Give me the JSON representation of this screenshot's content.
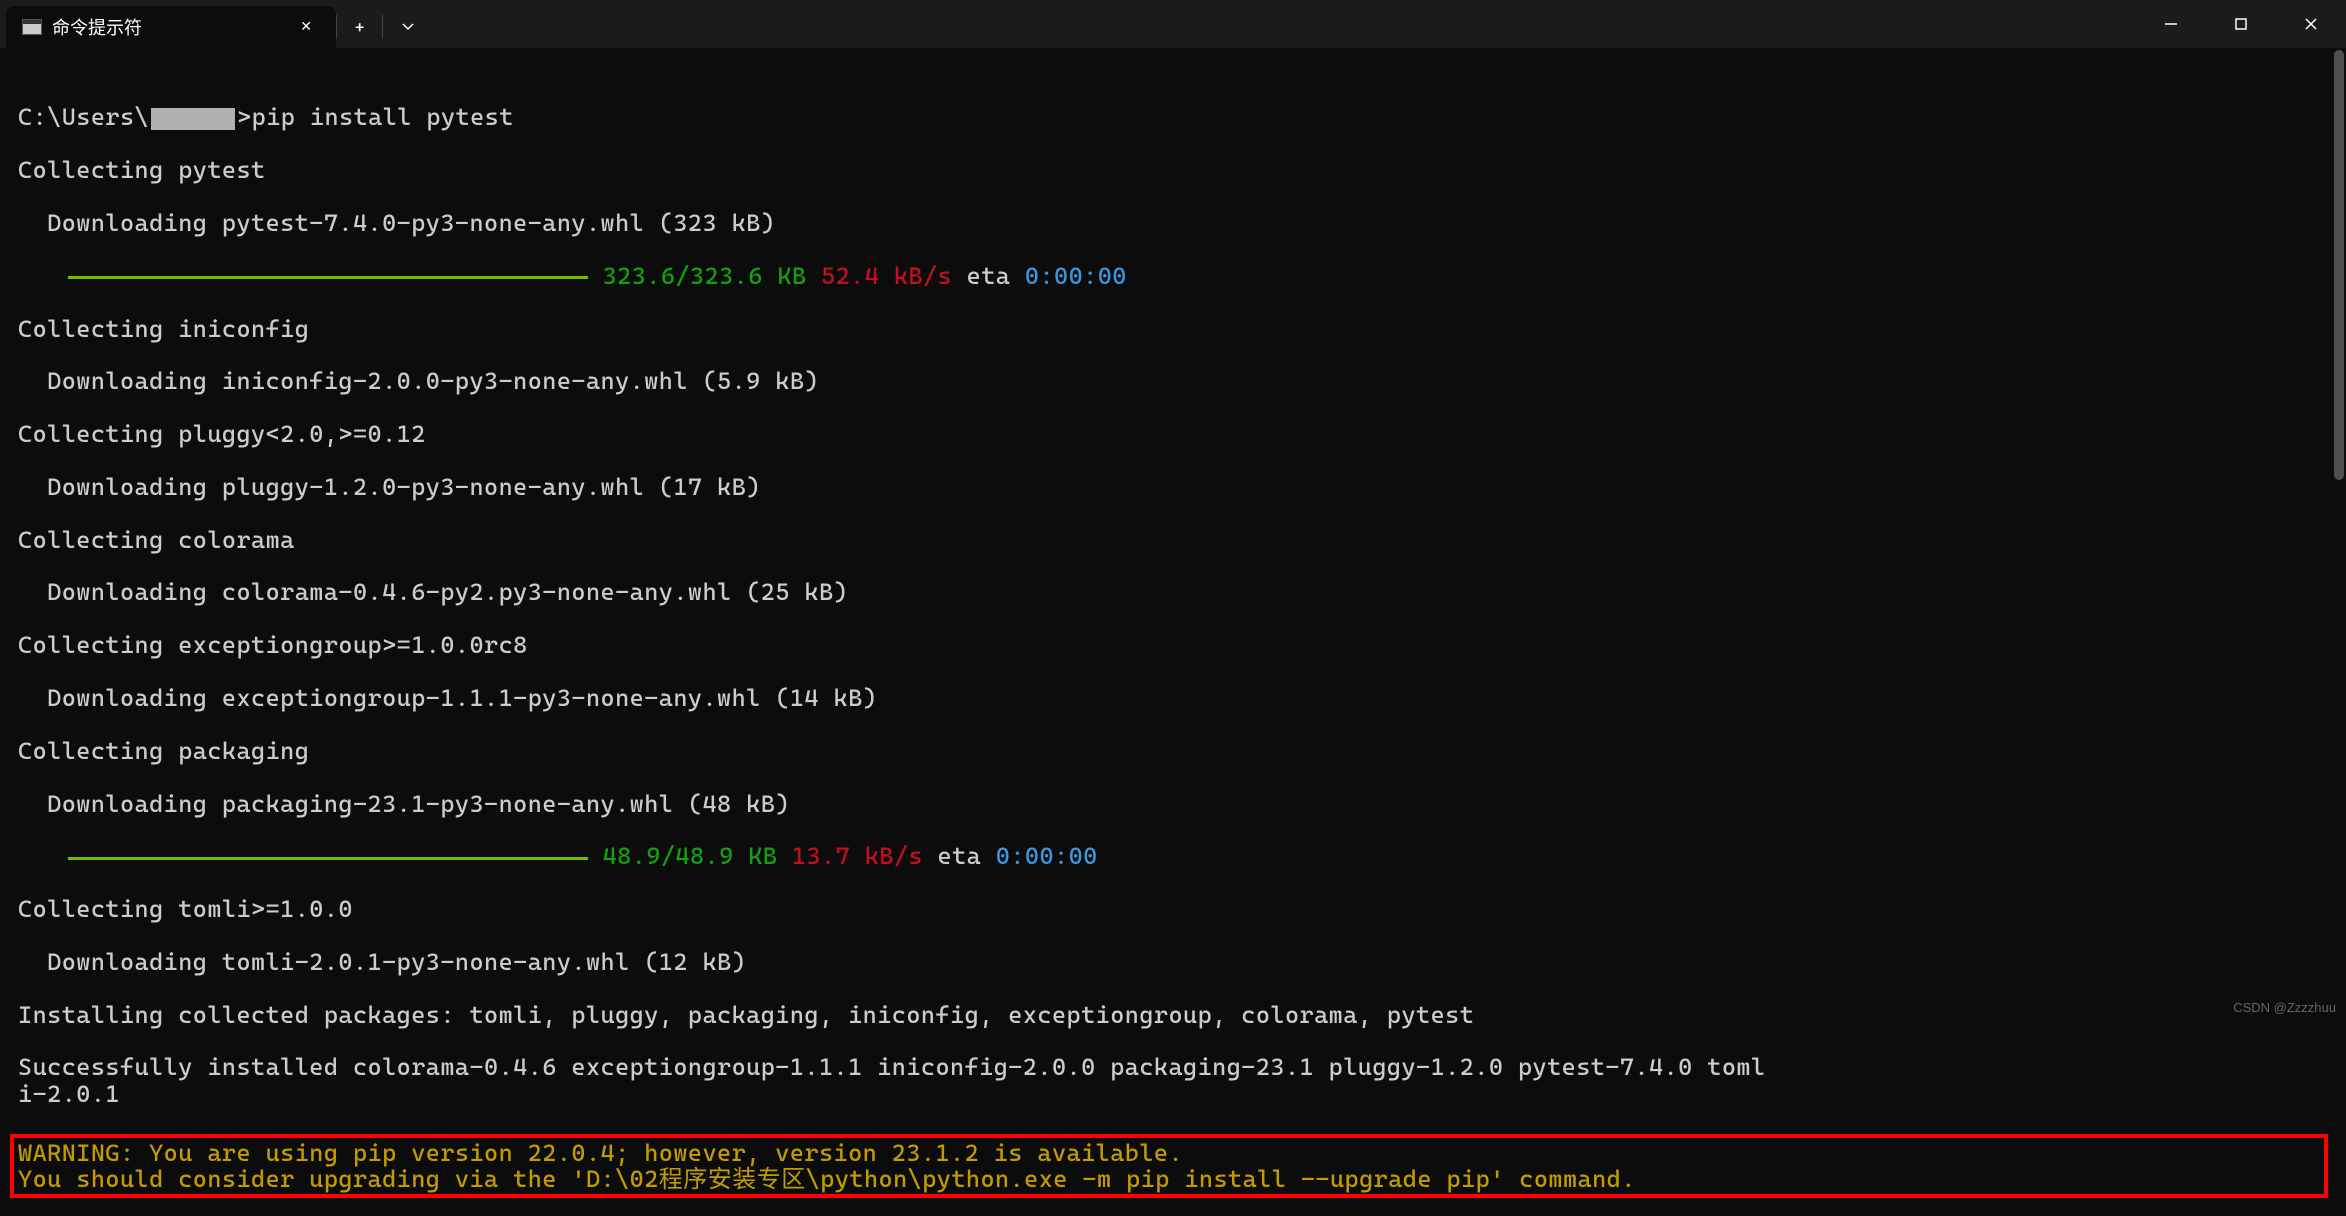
{
  "tab": {
    "title": "命令提示符"
  },
  "prompt": {
    "path_prefix": "C:\\Users\\",
    "path_suffix": ">",
    "command": "pip install pytest"
  },
  "lines": {
    "l1": "Collecting pytest",
    "l2": "  Downloading pytest-7.4.0-py3-none-any.whl (323 kB)",
    "l3_size": " 323.6/323.6 KB",
    "l3_speed": " 52.4 kB/s",
    "l3_eta_label": " eta ",
    "l3_eta": "0:00:00",
    "l4": "Collecting iniconfig",
    "l5": "  Downloading iniconfig-2.0.0-py3-none-any.whl (5.9 kB)",
    "l6": "Collecting pluggy<2.0,>=0.12",
    "l7": "  Downloading pluggy-1.2.0-py3-none-any.whl (17 kB)",
    "l8": "Collecting colorama",
    "l9": "  Downloading colorama-0.4.6-py2.py3-none-any.whl (25 kB)",
    "l10": "Collecting exceptiongroup>=1.0.0rc8",
    "l11": "  Downloading exceptiongroup-1.1.1-py3-none-any.whl (14 kB)",
    "l12": "Collecting packaging",
    "l13": "  Downloading packaging-23.1-py3-none-any.whl (48 kB)",
    "l14_size": " 48.9/48.9 KB",
    "l14_speed": " 13.7 kB/s",
    "l14_eta_label": " eta ",
    "l14_eta": "0:00:00",
    "l15": "Collecting tomli>=1.0.0",
    "l16": "  Downloading tomli-2.0.1-py3-none-any.whl (12 kB)",
    "l17": "Installing collected packages: tomli, pluggy, packaging, iniconfig, exceptiongroup, colorama, pytest",
    "l18": "Successfully installed colorama-0.4.6 exceptiongroup-1.1.1 iniconfig-2.0.0 packaging-23.1 pluggy-1.2.0 pytest-7.4.0 toml\ni-2.0.1",
    "warn1": "WARNING: You are using pip version 22.0.4; however, version 23.1.2 is available.",
    "warn2": "You should consider upgrading via the 'D:\\02程序安装专区\\python\\python.exe -m pip install --upgrade pip' command."
  },
  "watermark": "CSDN @Zzzzhuu"
}
